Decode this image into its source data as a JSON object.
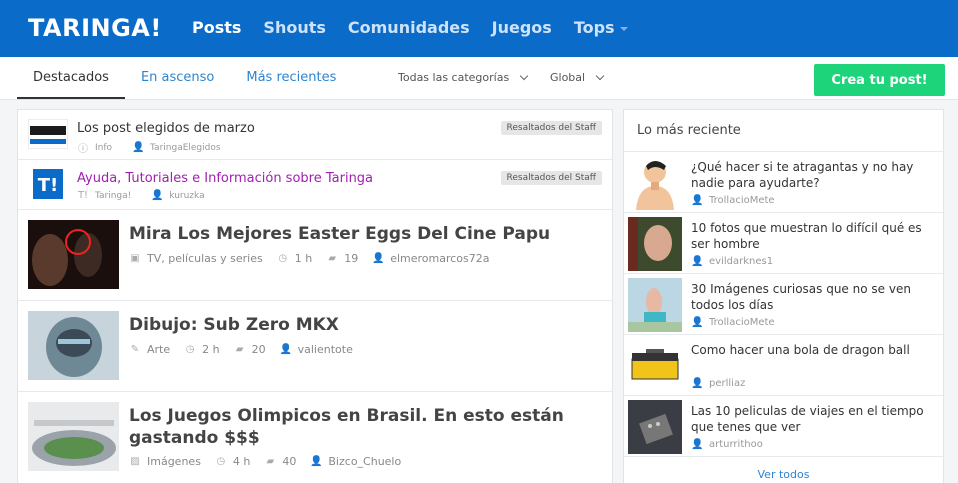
{
  "header": {
    "logo": "TARINGA!",
    "nav": [
      "Posts",
      "Shouts",
      "Comunidades",
      "Juegos",
      "Tops"
    ]
  },
  "subnav": {
    "tabs": [
      "Destacados",
      "En ascenso",
      "Más recientes"
    ],
    "category_filter": "Todas las categorías",
    "region_filter": "Global",
    "create_button": "Crea tu post!"
  },
  "pinned": [
    {
      "title": "Los post elegidos de marzo",
      "category": "Info",
      "user": "TaringaElegidos",
      "badge": "Resaltados del Staff"
    },
    {
      "title": "Ayuda, Tutoriales e Información sobre Taringa",
      "category": "Taringa!",
      "user": "kuruzka",
      "badge": "Resaltados del Staff"
    }
  ],
  "posts": [
    {
      "title": "Mira Los Mejores Easter Eggs Del Cine Papu",
      "category": "TV, películas y series",
      "time": "1 h",
      "comments": "19",
      "user": "elmeromarcos72a"
    },
    {
      "title": "Dibujo: Sub Zero MKX",
      "category": "Arte",
      "time": "2 h",
      "comments": "20",
      "user": "valientote"
    },
    {
      "title": "Los Juegos Olimpicos en Brasil. En esto están gastando $$$",
      "category": "Imágenes",
      "time": "4 h",
      "comments": "40",
      "user": "Bizco_Chuelo"
    }
  ],
  "sidebar": {
    "title": "Lo más reciente",
    "items": [
      {
        "title": "¿Qué hacer si te atragantas y no hay nadie para ayudarte?",
        "user": "TrollacioMete"
      },
      {
        "title": "10 fotos que muestran lo difícil qué es ser hombre",
        "user": "evildarknes1"
      },
      {
        "title": "30 Imágenes curiosas que no se ven todos los días",
        "user": "TrollacioMete"
      },
      {
        "title": "Como hacer una bola de dragon ball",
        "user": "perlliaz"
      },
      {
        "title": "Las 10 peliculas de viajes en el tiempo que tenes que ver",
        "user": "arturrithoo"
      }
    ],
    "see_all": "Ver todos"
  },
  "icons": {
    "info": "info-icon",
    "user": "user-icon",
    "clock": "clock-icon",
    "comment": "comment-icon",
    "tv": "tv-icon",
    "pencil": "pencil-icon",
    "image": "image-icon"
  },
  "colors": {
    "header": "#0a6bc9",
    "create_button": "#1ed47a",
    "link": "#2d85d0",
    "pinned_accent": "#a020b0"
  }
}
